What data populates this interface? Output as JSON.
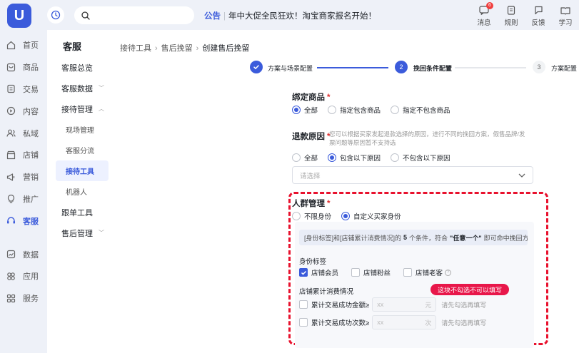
{
  "topbar": {
    "logo_text": "U",
    "search_placeholder": "",
    "notice_tag": "公告",
    "notice_text": "年中大促全民狂欢！淘宝商家报名开始！",
    "tools": [
      {
        "label": "消息",
        "badge": "6",
        "icon": "message-icon"
      },
      {
        "label": "规则",
        "icon": "rules-book-icon"
      },
      {
        "label": "反馈",
        "icon": "feedback-icon"
      },
      {
        "label": "学习",
        "icon": "learn-icon"
      }
    ]
  },
  "nav": {
    "items": [
      {
        "label": "首页",
        "icon": "home-icon"
      },
      {
        "label": "商品",
        "icon": "goods-icon"
      },
      {
        "label": "交易",
        "icon": "trade-icon"
      },
      {
        "label": "内容",
        "icon": "content-icon"
      },
      {
        "label": "私域",
        "icon": "private-domain-icon"
      },
      {
        "label": "店铺",
        "icon": "store-icon"
      },
      {
        "label": "营销",
        "icon": "marketing-icon"
      },
      {
        "label": "推广",
        "icon": "promotion-icon"
      },
      {
        "label": "客服",
        "icon": "customer-service-icon",
        "active": true
      },
      {
        "label": "数据",
        "icon": "data-icon"
      },
      {
        "label": "应用",
        "icon": "apps-icon"
      },
      {
        "label": "服务",
        "icon": "service-icon"
      }
    ]
  },
  "submenu": {
    "title": "客服",
    "overview": "客服总览",
    "data": "客服数据",
    "reception": "接待管理",
    "sub_items": [
      "现场管理",
      "客服分流",
      "接待工具",
      "机器人"
    ],
    "tools": "跟单工具",
    "after_sales": "售后管理"
  },
  "breadcrumb": [
    "接待工具",
    "售后挽留",
    "创建售后挽留"
  ],
  "steps": [
    {
      "label": "方案与场景配置",
      "state": "done"
    },
    {
      "label": "挽回条件配置",
      "number": "2",
      "state": "active"
    },
    {
      "label": "方案配置",
      "number": "3",
      "state": "todo"
    }
  ],
  "form": {
    "product": {
      "title": "绑定商品",
      "req": "*",
      "options": [
        "全部",
        "指定包含商品",
        "指定不包含商品"
      ],
      "selected": 0
    },
    "refund": {
      "title": "退款原因",
      "req": "*",
      "hint": "您可以根据买家发起退款选择的原因，进行不同的挽回方案，假售品牌/发票问题等原因暂不支持选",
      "options": [
        "全部",
        "包含以下原因",
        "不包含以下原因"
      ],
      "selected": 1,
      "select_placeholder": "请选择"
    },
    "crowd": {
      "title": "人群管理",
      "req": "*",
      "options": [
        "不限身份",
        "自定义买家身份"
      ],
      "selected": 1,
      "info_prefix": "[身份标签]和[店铺累计消费情况]的",
      "info_count": "5",
      "info_mid": "个条件，符合",
      "info_any": "\"任意一个\"",
      "info_suffix": "即可命中挽回方案",
      "identity_label": "身份标签",
      "identity_options": [
        {
          "label": "店铺会员",
          "checked": true
        },
        {
          "label": "店铺粉丝",
          "checked": false
        },
        {
          "label": "店铺老客",
          "checked": false
        }
      ],
      "consumption_label": "店铺累计消费情况",
      "annotation": "这块不勾选不可以填写",
      "rows": [
        {
          "label": "累计交易成功金额≥",
          "placeholder": "xx",
          "unit": "元",
          "hint": "请先勾选再填写"
        },
        {
          "label": "累计交易成功次数≥",
          "placeholder": "xx",
          "unit": "次",
          "hint": "请先勾选再填写"
        }
      ]
    }
  },
  "colors": {
    "primary": "#3b5bdb",
    "annotation_red": "#e8112d",
    "required": "#e03131"
  }
}
